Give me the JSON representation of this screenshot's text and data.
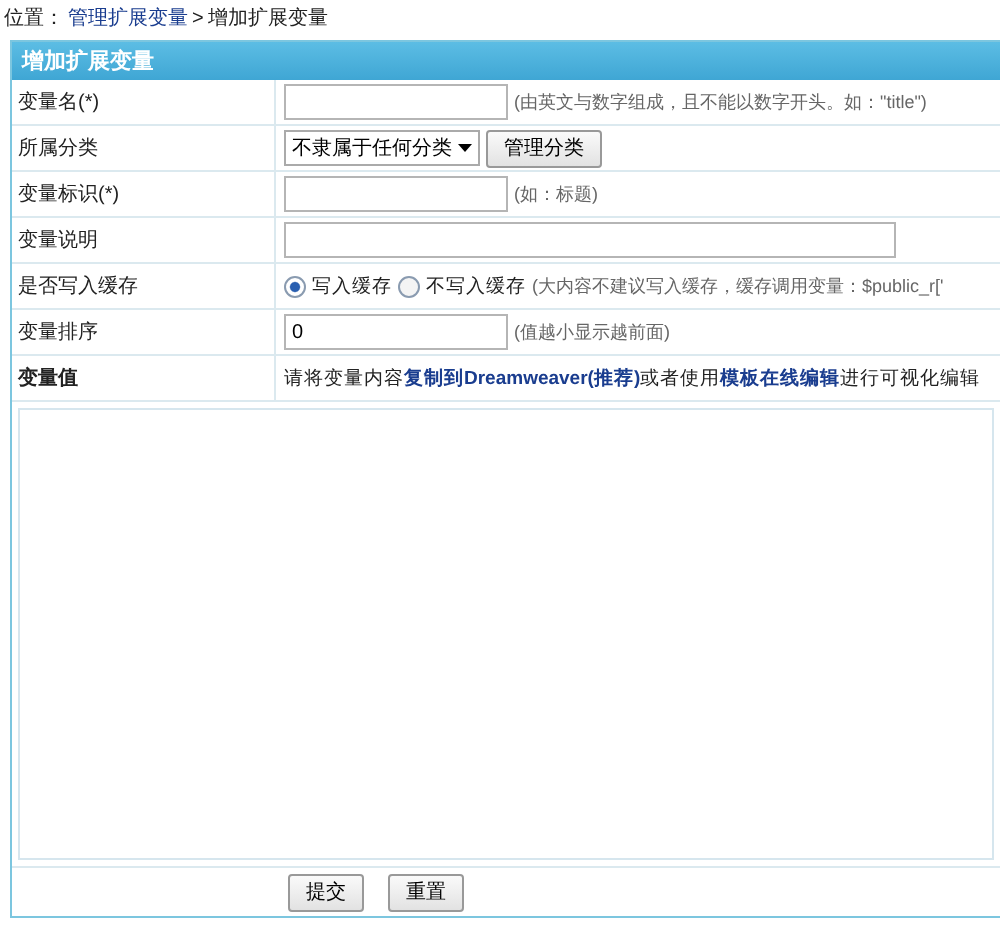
{
  "breadcrumb": {
    "prefix": "位置：",
    "link": "管理扩展变量",
    "separator": ">",
    "current": "增加扩展变量"
  },
  "panel": {
    "title": "增加扩展变量",
    "rows": [
      {
        "kind": "input",
        "label": "变量名(*)",
        "value": "",
        "wide": false,
        "hint": "(由英文与数字组成，且不能以数字开头。如：\"title\")"
      },
      {
        "kind": "select",
        "label": "所属分类",
        "value": "不隶属于任何分类",
        "button": "管理分类"
      },
      {
        "kind": "input",
        "label": "变量标识(*)",
        "value": "",
        "wide": false,
        "hint": "(如：标题)"
      },
      {
        "kind": "input",
        "label": "变量说明",
        "value": "",
        "wide": true
      },
      {
        "kind": "radio",
        "label": "是否写入缓存",
        "options": [
          {
            "label": "写入缓存",
            "selected": true
          },
          {
            "label": "不写入缓存",
            "selected": false
          }
        ],
        "hint": "(大内容不建议写入缓存，缓存调用变量：$public_r['"
      },
      {
        "kind": "input",
        "label": "变量排序",
        "value": "0",
        "wide": false,
        "hint": "(值越小显示越前面)"
      },
      {
        "kind": "note",
        "label": "变量值",
        "segments": [
          {
            "kind": "text",
            "text": "请将变量内容"
          },
          {
            "kind": "link",
            "text": "复制到Dreamweaver(推荐)"
          },
          {
            "kind": "text",
            "text": "或者使用"
          },
          {
            "kind": "link",
            "text": "模板在线编辑"
          },
          {
            "kind": "text",
            "text": "进行可视化编辑"
          }
        ]
      }
    ],
    "buttons": [
      "提交",
      "重置"
    ]
  }
}
